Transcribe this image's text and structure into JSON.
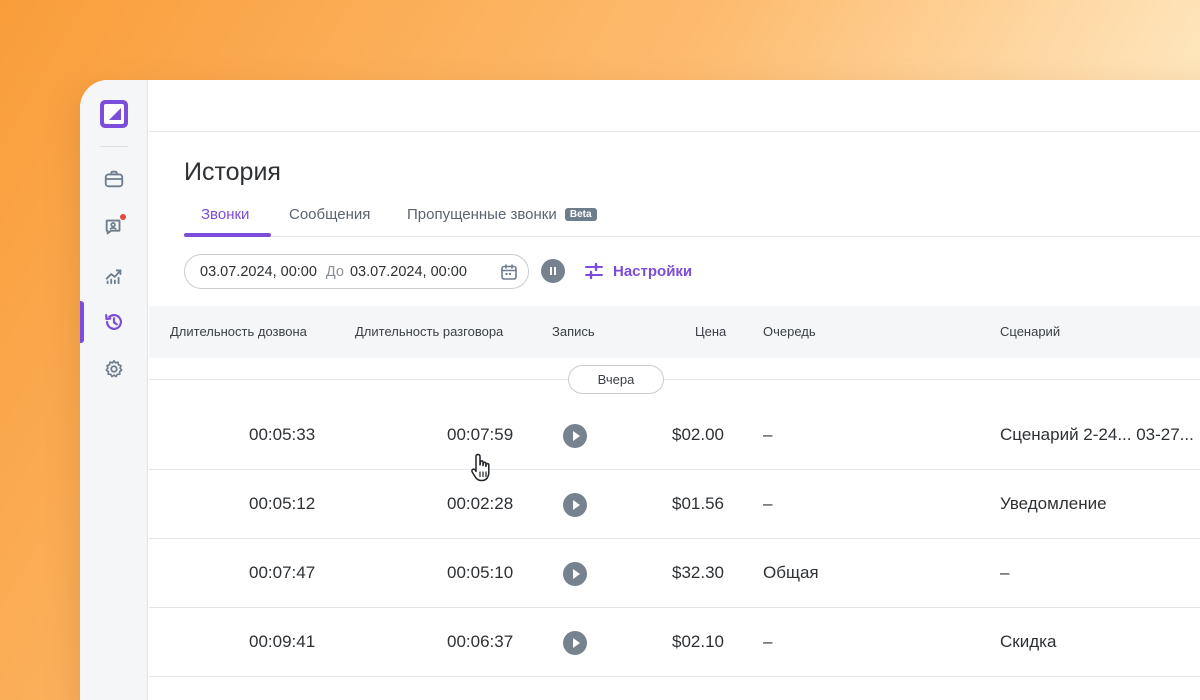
{
  "page": {
    "title": "История"
  },
  "tabs": [
    {
      "label": "Звонки",
      "active": true
    },
    {
      "label": "Сообщения",
      "active": false
    },
    {
      "label": "Пропущенные звонки",
      "badge": "Beta",
      "active": false
    }
  ],
  "filters": {
    "date_from": "03.07.2024, 00:00",
    "separator": "До",
    "date_to": "03.07.2024, 00:00",
    "settings_label": "Настройки"
  },
  "sidebar": {
    "items": [
      {
        "icon": "briefcase-icon",
        "active": false
      },
      {
        "icon": "contacts-icon",
        "active": false,
        "notification": true
      },
      {
        "icon": "analytics-icon",
        "active": false
      },
      {
        "icon": "history-icon",
        "active": true
      },
      {
        "icon": "gear-icon",
        "active": false
      }
    ]
  },
  "table": {
    "columns": [
      "Длительность дозвона",
      "Длительность разговора",
      "Запись",
      "Цена",
      "Очередь",
      "Сценарий"
    ],
    "group_label": "Вчера",
    "rows": [
      {
        "ring_duration": "00:05:33",
        "talk_duration": "00:07:59",
        "price": "$02.00",
        "queue": "–",
        "scenario": "Сценарий 2-24... 03-27..."
      },
      {
        "ring_duration": "00:05:12",
        "talk_duration": "00:02:28",
        "price": "$01.56",
        "queue": "–",
        "scenario": "Уведомление"
      },
      {
        "ring_duration": "00:07:47",
        "talk_duration": "00:05:10",
        "price": "$32.30",
        "queue": "Общая",
        "scenario": "–"
      },
      {
        "ring_duration": "00:09:41",
        "talk_duration": "00:06:37",
        "price": "$02.10",
        "queue": "–",
        "scenario": "Скидка"
      }
    ]
  },
  "colors": {
    "accent": "#7c4ddb",
    "play_button": "#76838f",
    "notification": "#e8453c"
  }
}
